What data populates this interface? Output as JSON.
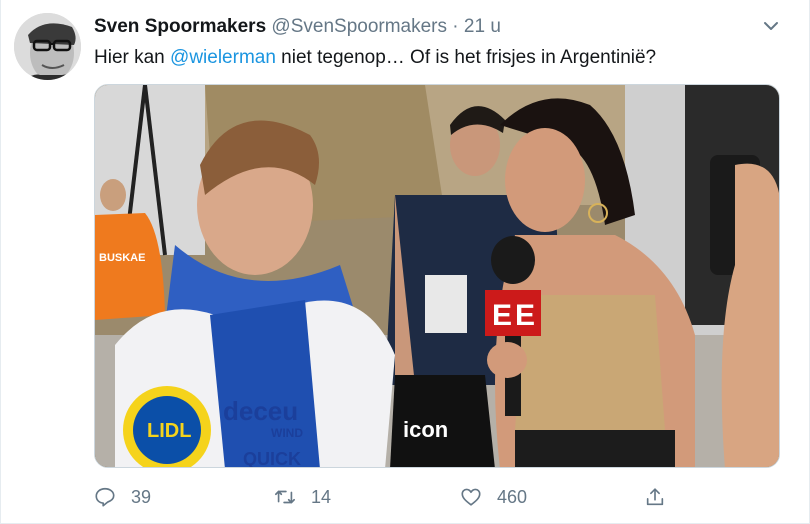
{
  "tweet": {
    "author_name": "Sven Spoormakers",
    "author_handle": "@SvenSpoormakers",
    "separator": "·",
    "time": "21 u",
    "text_before": "Hier kan ",
    "mention": "@wielerman",
    "text_after": " niet tegenop… Of is het frisjes in Argentinië?",
    "media_text": {
      "jersey_sponsor_1": "deceu",
      "jersey_sponsor_2": "WIND",
      "jersey_sponsor_3": "QUICK",
      "jersey_lidl": "LIDL",
      "mic_flag": "E",
      "bag_text": "icon",
      "rider_jersey": "BUSKAE"
    }
  },
  "actions": {
    "reply_icon": "reply-icon",
    "reply_count": "39",
    "retweet_icon": "retweet-icon",
    "retweet_count": "14",
    "like_icon": "heart-icon",
    "like_count": "460",
    "share_icon": "share-icon"
  },
  "colors": {
    "accent": "#1b95e0",
    "muted": "#657786",
    "text": "#14171a"
  }
}
